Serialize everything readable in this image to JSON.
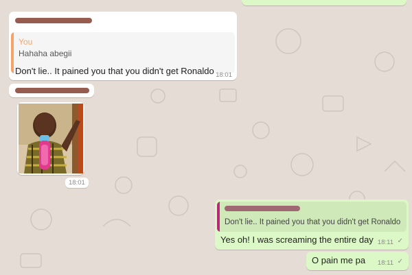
{
  "messages": {
    "m1": {
      "quote_author": "You",
      "quote_text": "Hahaha abegii",
      "text": "Don't lie..  It pained you that you didn't get Ronaldo",
      "time": "18:01"
    },
    "m2": {
      "photo_time": "18:01"
    },
    "m3": {
      "quote_text": "Don't lie..  It pained you that you didn't get Ronaldo",
      "text": "Yes oh! I was screaming the entire day",
      "time": "18:11"
    },
    "m4": {
      "text": "O pain me pa",
      "time": "18:11"
    }
  },
  "icons": {
    "read_receipt": "check-icon"
  },
  "colors": {
    "wallpaper": "#e5ddd5",
    "incoming": "#ffffff",
    "outgoing": "#dcf8c6",
    "quote_you_accent": "#f4a46a",
    "quote_other_accent": "#b8287a"
  }
}
